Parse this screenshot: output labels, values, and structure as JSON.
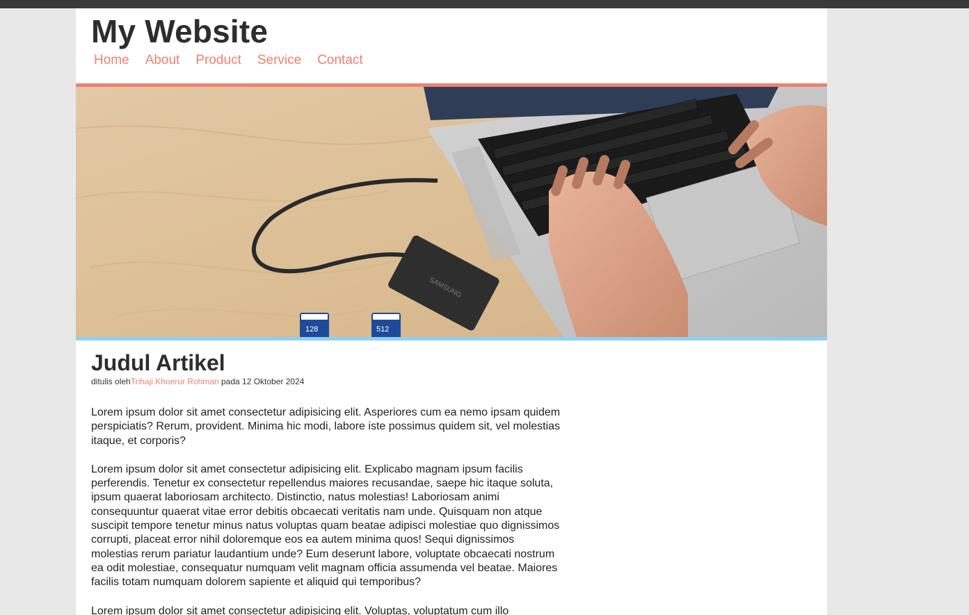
{
  "site": {
    "title": "My Website"
  },
  "nav": {
    "items": [
      "Home",
      "About",
      "Product",
      "Service",
      "Contact"
    ]
  },
  "hero": {
    "card1_label": "128",
    "card2_label": "512",
    "brand": "SAMSUNG"
  },
  "article": {
    "title": "Judul Artikel",
    "meta_prefix": "ditulis oleh",
    "author": "Trihaji Khoerur Rohman",
    "meta_suffix": " pada 12 Oktober 2024",
    "paragraphs": [
      "Lorem ipsum dolor sit amet consectetur adipisicing elit. Asperiores cum ea nemo ipsam quidem perspiciatis? Rerum, provident. Minima hic modi, labore iste possimus quidem sit, vel molestias itaque, et corporis?",
      "Lorem ipsum dolor sit amet consectetur adipisicing elit. Explicabo magnam ipsum facilis perferendis. Tenetur ex consectetur repellendus maiores recusandae, saepe hic itaque soluta, ipsum quaerat laboriosam architecto. Distinctio, natus molestias! Laboriosam animi consequuntur quaerat vitae error debitis obcaecati veritatis nam unde. Quisquam non atque suscipit tempore tenetur minus natus voluptas quam beatae adipisci molestiae quo dignissimos corrupti, placeat error nihil doloremque eos ea autem minima quos! Sequi dignissimos molestias rerum pariatur laudantium unde? Eum deserunt labore, voluptate obcaecati nostrum ea odit molestiae, consequatur numquam velit magnam officia assumenda vel beatae. Maiores facilis totam numquam dolorem sapiente et aliquid qui temporibus?",
      "Lorem ipsum dolor sit amet consectetur adipisicing elit. Voluptas, voluptatum cum illo"
    ]
  },
  "colors": {
    "accent": "#f08070",
    "hero_bottom_border": "#8fd0f0",
    "background": "#e8e8e8"
  }
}
